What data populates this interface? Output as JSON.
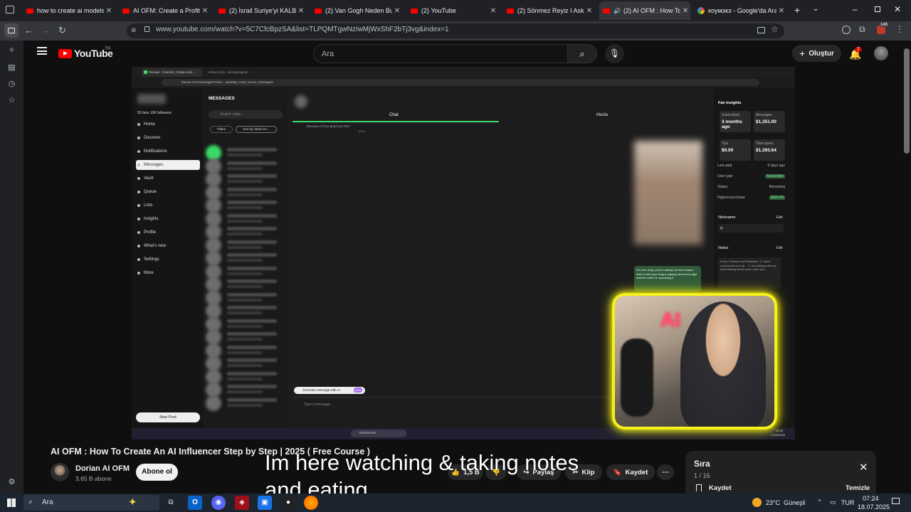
{
  "browser": {
    "tabs": [
      {
        "title": "how to create ai models fo",
        "type": "yt"
      },
      {
        "title": "AI OFM: Create a Profitable",
        "type": "yt"
      },
      {
        "title": "(2) İsrail Suriye'yi KALBİNDE",
        "type": "yt"
      },
      {
        "title": "(2) Van Gogh Neden Bu Ka",
        "type": "yt"
      },
      {
        "title": "(2) YouTube",
        "type": "yt"
      },
      {
        "title": "(2) Sönmez Reyiz I Askerlik",
        "type": "yt"
      },
      {
        "title": "(2) AI OFM : How To Cr",
        "type": "yt",
        "active": true
      },
      {
        "title": "коумэкэ - Google'da Ara",
        "type": "google"
      }
    ],
    "url": "www.youtube.com/watch?v=5C7CfcBpzSA&list=TLPQMTgwNzIwMjWxShF2bTj3vg&index=1",
    "extension_badge": "146"
  },
  "youtube": {
    "logo_text": "YouTube",
    "region": "TR",
    "search_placeholder": "Ara",
    "create_label": "Oluştur",
    "notif_count": "2"
  },
  "video_content": {
    "tab1": "Fanvue - Connect, Create and ...",
    "tab2": "Inbox (441) - secretprogram",
    "url": "fanvue.com/messages?chat=...&sortBy=most_recent_messages",
    "profile_stats": "55 fans  10K followers",
    "sidebar": [
      "Home",
      "Discover",
      "Notifications",
      "Messages",
      "Vault",
      "Queue",
      "Lists",
      "Insights",
      "Profile",
      "What's new",
      "Settings",
      "More"
    ],
    "new_post": "New Post",
    "messages_title": "MESSAGES",
    "search_chats": "Search chats...",
    "filters": "Filters",
    "sort": "Sort by: Most rec...",
    "chat_tab": "Chat",
    "media_tab": "Media",
    "msg_snippet": "because of how good you feel",
    "msg_time": "10:24",
    "incoming_msg": "Oh fuck, baby, you're making me alive today! I want to feel your tongue playing around my tight asshole while I'm spreading it",
    "generate_label": "Generate message with AI",
    "generate_badge": "Beta",
    "type_placeholder": "Type a message...",
    "insights": {
      "title": "Fan insights",
      "cards": [
        {
          "label": "Subscribed",
          "value": "3 months ago"
        },
        {
          "label": "Messages",
          "value": "$1,351.00"
        },
        {
          "label": "Tips",
          "value": "$0.00"
        },
        {
          "label": "Total spent",
          "value": "$1,393.64"
        }
      ],
      "rows": [
        {
          "label": "Last paid",
          "value": "6 days ago"
        },
        {
          "label": "User type",
          "value": "Subscriber"
        },
        {
          "label": "Status",
          "value": "Renewing"
        },
        {
          "label": "Highest purchase",
          "value": "$000.00"
        }
      ],
      "nickname_label": "Nickname",
      "nickname_value": "ty",
      "notes_label": "Notes",
      "edit": "Edit",
      "notes_text": "Kinks, Fetishes and Fantasies: 1 I wish I could knock you up... 1 I am playing with my dick thinking about what I want you..."
    },
    "taskbar_search": "Rechercher",
    "clock": "22:06",
    "date": "17/04/2025"
  },
  "video_meta": {
    "title": "AI OFM : How To Create An AI Influencer Step by Step | 2025 ( Free Course )",
    "channel": "Dorian AI OFM",
    "subscribers": "3,65 B abone",
    "subscribe_label": "Abone ol",
    "likes": "1,5 B",
    "share": "Paylaş",
    "clip": "Klip",
    "save": "Kaydet",
    "overlay_text": "Im here watching & taking notes\nand eating"
  },
  "queue": {
    "title": "Sıra",
    "position": "1 / 16",
    "save": "Kaydet",
    "clear": "Temizle"
  },
  "taskbar": {
    "search": "Ara",
    "weather": "23°C",
    "weather_desc": "Güneşli",
    "lang": "TUR",
    "time": "07:24",
    "date": "18.07.2025"
  },
  "colors": {
    "yt_red": "#ff0000",
    "webcam_border": "#f5f21a",
    "fanvue_green": "#3bd96a",
    "generate_purple": "#a56cf0"
  }
}
